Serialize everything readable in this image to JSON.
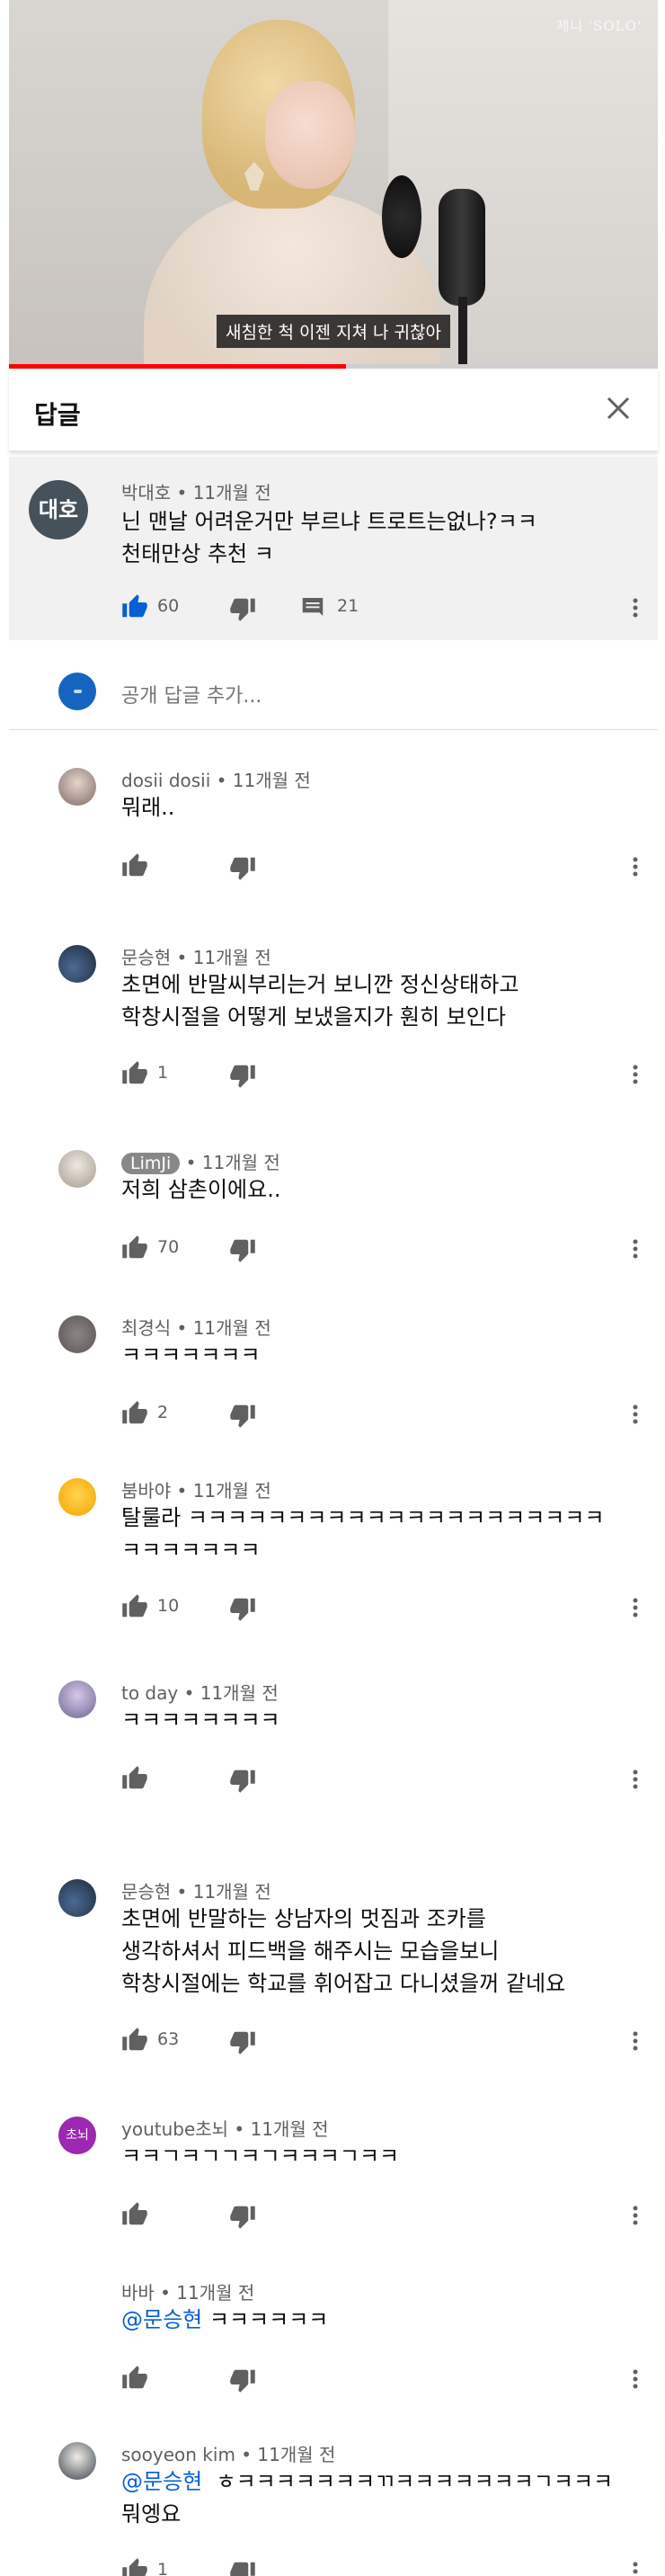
{
  "video": {
    "watermark": "제니 'SOLO'",
    "subtitle": "새침한 척 이젠 지쳐 나 귀찮아",
    "progress_fraction": 0.52,
    "accent_color": "#ff0000"
  },
  "panel": {
    "title": "답글",
    "close_icon": "close-icon"
  },
  "parent_comment": {
    "avatar_text": "대호",
    "meta": "박대호 • 11개월 전",
    "lines": [
      "닌 맨날 어려운거만 부르냐 트로트는없나?ㅋㅋ",
      "천태만상 추천 ㅋ"
    ],
    "likes": "60",
    "replies": "21"
  },
  "add_reply": {
    "placeholder": "공개 답글 추가..."
  },
  "replies": [
    {
      "meta": "dosii dosii • 11개월 전",
      "lines": [
        "뭐래.."
      ],
      "likes": ""
    },
    {
      "meta": "문승현 • 11개월 전",
      "lines": [
        "초면에 반말씨부리는거 보니깐 정신상태하고",
        "학창시절을 어떻게 보냈을지가 훤히 보인다"
      ],
      "likes": "1"
    },
    {
      "name_chip": "LimJi",
      "meta_suffix": " • 11개월 전",
      "lines": [
        "저희 삼촌이에요.."
      ],
      "likes": "70"
    },
    {
      "meta": "최경식 • 11개월 전",
      "lines": [
        "ㅋㅋㅋㅋㅋㅋㅋ"
      ],
      "likes": "2"
    },
    {
      "meta": "붐바야 • 11개월 전",
      "lines": [
        "탈룰라 ㅋㅋㅋㅋㅋㅋㅋㅋㅋㅋㅋㅋㅋㅋㅋㅋㅋㅋㅋㅋㅋ",
        "ㅋㅋㅋㅋㅋㅋㅋ"
      ],
      "likes": "10"
    },
    {
      "meta": "to day • 11개월 전",
      "lines": [
        "ㅋㅋㅋㅋㅋㅋㅋㅋ"
      ],
      "likes": ""
    },
    {
      "meta": "문승현 • 11개월 전",
      "lines": [
        "초면에 반말하는 상남자의 멋짐과 조카를",
        "생각하셔서 피드백을 해주시는 모습을보니",
        "학창시절에는 학교를 휘어잡고 다니셨을꺼 같네요"
      ],
      "likes": "63"
    },
    {
      "avatar_text": "초뇌",
      "meta": "youtube초뇌 • 11개월 전",
      "lines": [
        "ㅋㅋㄱㅋㄱㄱㅋㄱㅋㅋㅋㄱㅋㅋ"
      ],
      "likes": ""
    },
    {
      "meta": "바바 • 11개월 전",
      "mention": "@문승현",
      "lines": [
        " ㅋㅋㅋㅋㅋㅋ"
      ],
      "likes": ""
    },
    {
      "meta": "sooyeon kim • 11개월 전",
      "mention": "@문승현",
      "lines": [
        "  ㅎㅋㅋㅋㅋㅋㅋㅋㄲㅋㅋㅋㅋㅋㅋㅋㄱㅋㅋㅋ",
        "뭐엥요"
      ],
      "likes": "1"
    }
  ]
}
